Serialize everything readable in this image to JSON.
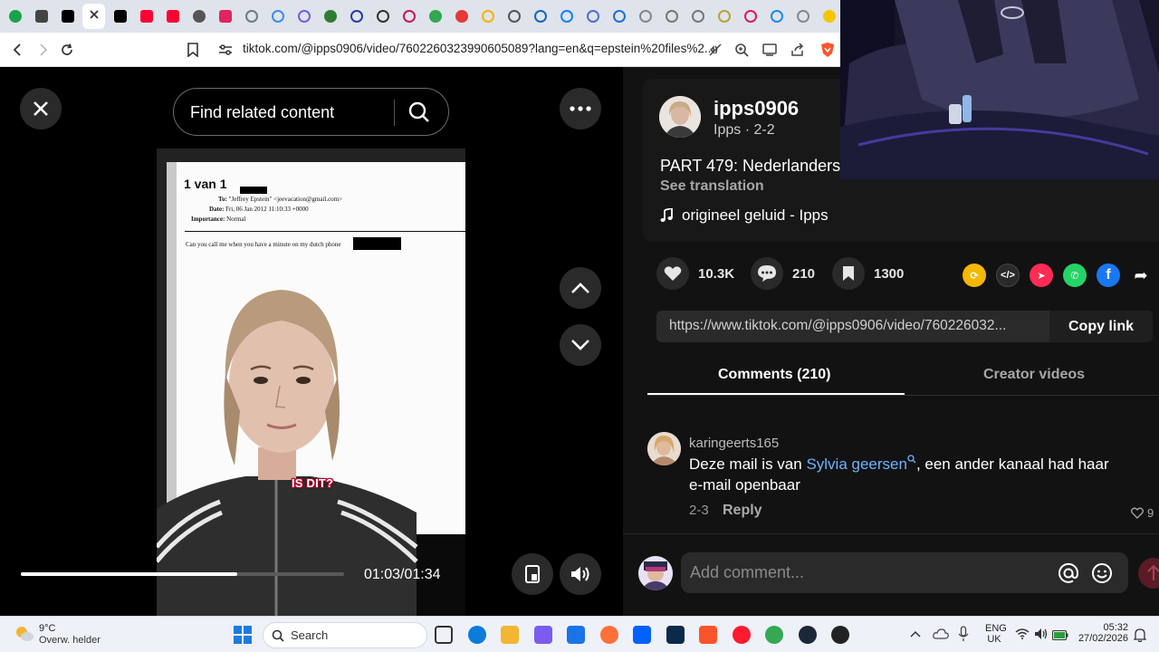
{
  "browser": {
    "url": "tiktok.com/@ipps0906/video/7602260323990605089?lang=en&q=epstein%20files%2...",
    "tabs": [
      {
        "icon": "green-circle-icon",
        "color": "#1aa34a"
      },
      {
        "icon": "screenshot-icon",
        "color": "#444444"
      },
      {
        "icon": "tiktok-icon",
        "color": "#000000"
      },
      {
        "icon": "close-icon",
        "color": "#333333",
        "active": true
      },
      {
        "icon": "tiktok-icon",
        "color": "#000000"
      },
      {
        "icon": "youtube-icon",
        "color": "#ff0033"
      },
      {
        "icon": "youtube-icon",
        "color": "#ff0033"
      },
      {
        "icon": "chatgpt-icon",
        "color": "#555555"
      },
      {
        "icon": "brand-red-icon",
        "color": "#e0245e"
      },
      {
        "icon": "ring-icon",
        "color": "#6b7b8c"
      },
      {
        "icon": "ring-icon",
        "color": "#3a8ee6"
      },
      {
        "icon": "ring-icon",
        "color": "#7a5ae0"
      },
      {
        "icon": "green-circle-icon",
        "color": "#2e7d32"
      },
      {
        "icon": "ring-icon",
        "color": "#2b3a9e"
      },
      {
        "icon": "ring-icon",
        "color": "#333333"
      },
      {
        "icon": "ring-icon",
        "color": "#c2185b"
      },
      {
        "icon": "green-circle-icon",
        "color": "#2fa84f"
      },
      {
        "icon": "red-circle-icon",
        "color": "#e53935"
      },
      {
        "icon": "ring-icon",
        "color": "#f2b400"
      },
      {
        "icon": "ring-icon",
        "color": "#555555"
      },
      {
        "icon": "ring-icon",
        "color": "#1565c0"
      },
      {
        "icon": "ring-icon",
        "color": "#0a84ff"
      },
      {
        "icon": "ring-icon",
        "color": "#4a6fd1"
      },
      {
        "icon": "ring-icon",
        "color": "#1f6fd8"
      },
      {
        "icon": "ring-icon",
        "color": "#888888"
      },
      {
        "icon": "ring-icon",
        "color": "#777777"
      },
      {
        "icon": "ring-icon",
        "color": "#777777"
      },
      {
        "icon": "ring-icon",
        "color": "#b9a23a"
      },
      {
        "icon": "ring-icon",
        "color": "#d81b60"
      },
      {
        "icon": "ring-icon",
        "color": "#1e88e5"
      },
      {
        "icon": "ring-icon",
        "color": "#888888"
      },
      {
        "icon": "yellow-circle-icon",
        "color": "#f7c400"
      }
    ]
  },
  "video": {
    "search_placeholder": "Find related content",
    "doc": {
      "page": "1 van 1",
      "to": "To: \"Jeffrey Epstein\" <jeevacation@gmail.com>",
      "to_label": "To:",
      "to_value": "\"Jeffrey Epstein\" <jeevacation@gmail.com>",
      "date_label": "Date:",
      "date_value": "Fri, 06 Jan 2012 11:10:33 +0000",
      "importance_label": "Importance:",
      "importance_value": "Normal",
      "body": "Can you call me when you have a minute on my dutch phone"
    },
    "caption": "IS DIT?",
    "progress": 0.67,
    "time": "01:03/01:34"
  },
  "post": {
    "username": "ipps0906",
    "nickname": "Ipps · 2-2",
    "title": "PART 479: Nederlanders",
    "see_translation": "See translation",
    "sound": "origineel geluid - Ipps",
    "likes": "10.3K",
    "comments": "210",
    "saves": "1300",
    "link": "https://www.tiktok.com/@ipps0906/video/760226032...",
    "copy_link": "Copy link",
    "share_targets": [
      {
        "name": "repost-icon",
        "color": "#f5b800",
        "glyph": "⟳"
      },
      {
        "name": "embed-icon",
        "color": "#2a2a2a",
        "glyph": "</>"
      },
      {
        "name": "send-icon",
        "color": "#fe2c55",
        "glyph": "➤"
      },
      {
        "name": "whatsapp-icon",
        "color": "#25d366",
        "glyph": "✆"
      },
      {
        "name": "facebook-icon",
        "color": "#1877f2",
        "glyph": "f"
      },
      {
        "name": "share-arrow-icon",
        "color": "#121212",
        "glyph": "➦"
      }
    ]
  },
  "tabs": {
    "comments": "Comments (210)",
    "creator_videos": "Creator videos"
  },
  "comment": {
    "user": "karingeerts165",
    "text_before": "Deze mail is van ",
    "mention": "Sylvia geersen",
    "text_after": ", een ander kanaal had haar e-mail openbaar",
    "date": "2-3",
    "reply": "Reply",
    "likes": "9"
  },
  "composer": {
    "placeholder": "Add comment..."
  },
  "taskbar": {
    "temp": "9°C",
    "weather": "Overw. helder",
    "search": "Search",
    "lang_top": "ENG",
    "lang_bottom": "UK",
    "clock_time": "05:32",
    "clock_date": "27/02/2026",
    "apps": [
      {
        "name": "task-view-icon",
        "color": "#333333"
      },
      {
        "name": "edge-icon",
        "color": "#0c7bd9"
      },
      {
        "name": "file-explorer-icon",
        "color": "#f2b632"
      },
      {
        "name": "copilot-icon",
        "color": "#7b5cf0"
      },
      {
        "name": "store-icon",
        "color": "#1a73e8"
      },
      {
        "name": "firefox-icon",
        "color": "#ff7139"
      },
      {
        "name": "dropbox-icon",
        "color": "#0061fe"
      },
      {
        "name": "photoshop-icon",
        "color": "#0b2a4a"
      },
      {
        "name": "brave-icon",
        "color": "#fb542b"
      },
      {
        "name": "opera-icon",
        "color": "#ff1b2d"
      },
      {
        "name": "chrome-icon",
        "color": "#34a853"
      },
      {
        "name": "steam-icon",
        "color": "#1b2838"
      },
      {
        "name": "media-player-icon",
        "color": "#222222"
      }
    ]
  }
}
